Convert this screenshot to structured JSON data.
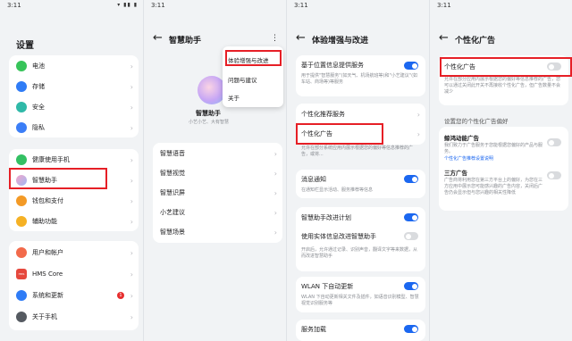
{
  "statusbar": {
    "time": "3:11",
    "right": "▾ ▮▮ ▮"
  },
  "panel1": {
    "title": "设置",
    "group1": [
      {
        "label": "电池",
        "color": "#37c45a"
      },
      {
        "label": "存储",
        "color": "#2f7cf6"
      },
      {
        "label": "安全",
        "color": "#2fb9a8"
      },
      {
        "label": "隐私",
        "color": "#3b7ef7"
      }
    ],
    "group2": [
      {
        "label": "健康使用手机",
        "color": "#33c063"
      },
      {
        "label": "智慧助手",
        "color": "#b98cf0"
      },
      {
        "label": "钱包和支付",
        "color": "#f39a26"
      },
      {
        "label": "辅助功能",
        "color": "#f5b125"
      }
    ],
    "group3": [
      {
        "label": "用户和帐户",
        "color": "#f26a4b"
      },
      {
        "label": "HMS Core",
        "color": "#e6483d",
        "badge": "HMS"
      },
      {
        "label": "系统和更新",
        "color": "#2f7cf6",
        "dot": "1"
      },
      {
        "label": "关于手机",
        "color": "#555a61"
      }
    ]
  },
  "panel2": {
    "title": "智慧助手",
    "menu": [
      "体验增强与改进",
      "问题与建议",
      "关于"
    ],
    "name": "智慧助手",
    "subtitle": "小艺小艺、大有智慧",
    "items": [
      "智慧语音",
      "智慧视觉",
      "智慧识屏",
      "小艺建议",
      "智慧场景"
    ]
  },
  "panel3": {
    "title": "体验增强与改进",
    "loc_label": "基于位置信息提供服务",
    "loc_desc": "用于提供\"智慧服务\"(如天气、机场航班等)和\"小艺建议\"(如车站、商场等)等服务",
    "rec": "个性化推荐服务",
    "ad": "个性化广告",
    "ad_desc": "允许在部分系统应用内展示根据您的偏好等信息推荐的广告，或将...",
    "notify": "消息通知",
    "notify_desc": "在通知栏显示活动、服务推荐等信息",
    "plan": "智慧助手改进计划",
    "plan2": "使用实体信息改进智慧助手",
    "plan_desc": "开启后，允许通过记录、识别声音，翻译文字等来数据，从而改进智慧助手",
    "wlan": "WLAN 下自动更新",
    "wlan_desc": "WLAN 下自动更新相关文件及插件，如语音识别模型、智慧视觉识别服务等",
    "more": "服务加载"
  },
  "panel4": {
    "title": "个性化广告",
    "ad": "个性化广告",
    "ad_desc": "允许在部分应用内展示根据您的偏好等信息推荐的广告，您可以通过关闭此开关不再接收个性化广告，但广告数量不会减少",
    "section": "设置您的个性化广告偏好",
    "g1_title": "鲸鸿动能广告",
    "g1_desc": "我们致力于广告服务于您能根据您偏好的产品与服务。",
    "g1_link": "个性化广告推荐设置说明",
    "g2_title": "三方广告",
    "g2_desc": "广告商将利用您在第三方平台上的偏好，为您在三方应用中展示您可能感兴趣的广告内容，关闭后广告仍会显示但与您兴趣的相关性降低"
  }
}
